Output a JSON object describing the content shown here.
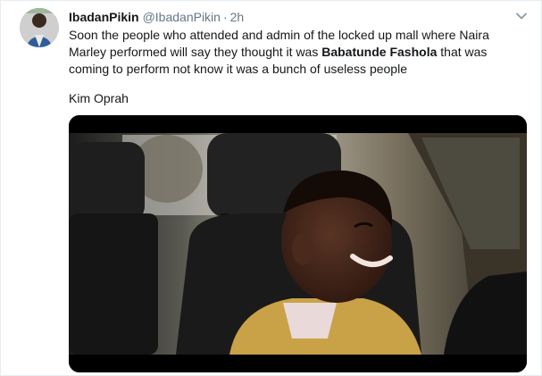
{
  "tweet": {
    "display_name": "IbadanPikin",
    "handle": "@IbadanPikin",
    "separator": "·",
    "time": "2h",
    "text_part1": "Soon the people who attended and admin of the locked up mall where Naira Marley performed will say they thought it was ",
    "text_bold": "Babatunde Fashola",
    "text_part2": " that was coming to perform not know it was a bunch of useless people",
    "signoff": "Kim Oprah"
  },
  "icons": {
    "caret": "chevron-down-icon"
  },
  "colors": {
    "text": "#14171a",
    "secondary": "#657786",
    "border": "#e6ecf0"
  }
}
